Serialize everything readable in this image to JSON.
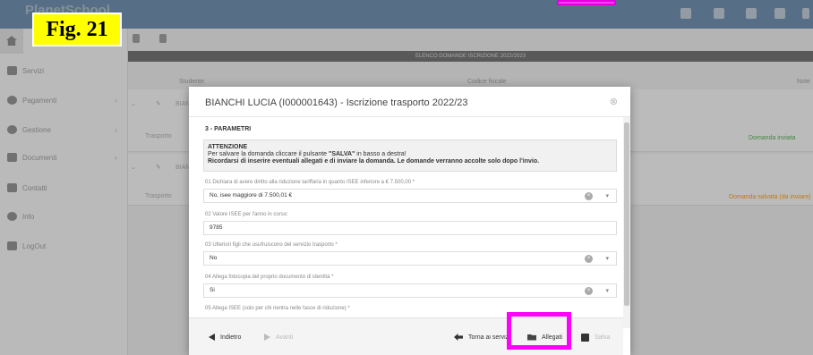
{
  "app": {
    "brand": "PlanetSchool"
  },
  "figure_label": "Fig. 21",
  "sidebar": {
    "items": [
      {
        "label": "Servizi",
        "icon": "grid-icon"
      },
      {
        "label": "Pagamenti",
        "icon": "euro-icon"
      },
      {
        "label": "Gestione",
        "icon": "gear-icon"
      },
      {
        "label": "Documenti",
        "icon": "document-icon"
      },
      {
        "label": "Contatti",
        "icon": "envelope-icon"
      },
      {
        "label": "Info",
        "icon": "info-icon"
      },
      {
        "label": "LogOut",
        "icon": "logout-icon"
      }
    ]
  },
  "list": {
    "title": "ELENCO DOMANDE ISCRIZIONE 2022/2023",
    "columns": [
      "Studente",
      "Codice fiscale",
      "Note"
    ],
    "rows": [
      {
        "student": "BIAN",
        "service": "Trasporto",
        "status": "Domanda inviata",
        "status_color": "#4caf50"
      },
      {
        "student": "BIAN",
        "service": "Trasporto",
        "status": "Domanda salvata (da inviare)",
        "status_color": "#ff9800"
      }
    ]
  },
  "modal": {
    "title": "BIANCHI LUCIA (I000001643) - Iscrizione trasporto 2022/23",
    "section": "3 - PARAMETRI",
    "notice": {
      "heading": "ATTENZIONE",
      "line1_pre": "Per salvare la domanda cliccare il pulsante ",
      "line1_bold": "\"SALVA\"",
      "line1_post": " in basso a destra!",
      "line2": "Ricordarsi di inserire eventuali allegati e di inviare la domanda. Le domande verranno accolte solo dopo l'invio."
    },
    "fields": [
      {
        "label": "01 Dichiara di avere diritto alla riduzione tariffaria in quanto ISEE inferiore a € 7.500,00 *",
        "value": "No, isee maggiore di 7.500,01 €",
        "select": true
      },
      {
        "label": "02 Valore ISEE per l'anno in corso:",
        "value": "9785",
        "select": false
      },
      {
        "label": "03 Ulteriori figli che usufruiscono del servizio trasporto *",
        "value": "No",
        "select": true
      },
      {
        "label": "04 Allega fotocopia del proprio documento di identità *",
        "value": "Si",
        "select": true
      },
      {
        "label": "05 Allega ISEE (solo per chi rientra nelle fasce di riduzione) *",
        "value": "",
        "select": false
      }
    ],
    "footer": {
      "back": "Indietro",
      "next": "Avanti",
      "back_to_services": "Torna ai servizi",
      "attachments": "Allegati",
      "save": "Salva"
    }
  },
  "colors": {
    "highlight": "#ff00ff",
    "topbar": "#6a8aac",
    "figure_bg": "#ffff00"
  }
}
